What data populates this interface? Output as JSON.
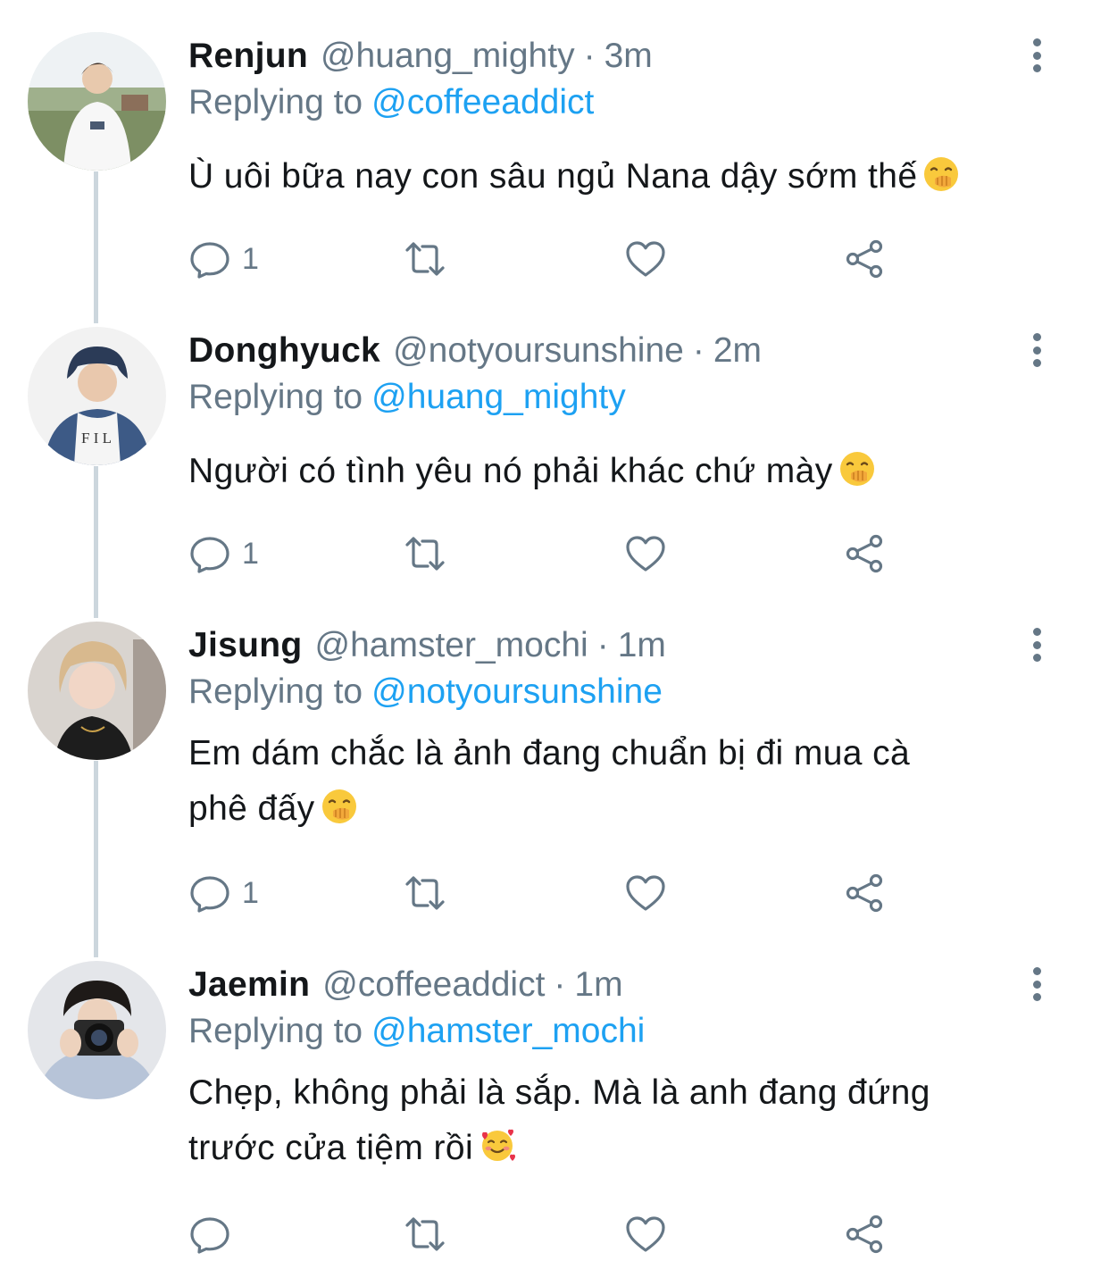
{
  "tweets": [
    {
      "name": "Renjun",
      "handle": "@huang_mighty",
      "time": "3m",
      "replying_label": "Replying to",
      "replying_to": "@coffeeaddict",
      "text": "Ù uôi bữa nay con sâu ngủ Nana dậy sớm thế",
      "emoji": "face-with-hand-over-mouth",
      "reply_count": "1"
    },
    {
      "name": "Donghyuck",
      "handle": "@notyoursunshine",
      "time": "2m",
      "replying_label": "Replying to",
      "replying_to": "@huang_mighty",
      "text": "Người có tình yêu nó phải khác chứ mày",
      "emoji": "face-with-hand-over-mouth",
      "reply_count": "1"
    },
    {
      "name": "Jisung",
      "handle": "@hamster_mochi",
      "time": "1m",
      "replying_label": "Replying to",
      "replying_to": "@notyoursunshine",
      "text_line1": "Em dám chắc là ảnh đang chuẩn bị đi mua cà",
      "text_line2": "phê đấy",
      "emoji": "face-with-hand-over-mouth",
      "reply_count": "1"
    },
    {
      "name": "Jaemin",
      "handle": "@coffeeaddict",
      "time": "1m",
      "replying_label": "Replying to",
      "replying_to": "@hamster_mochi",
      "text_line1": "Chẹp, không phải là sắp. Mà là anh đang đứng",
      "text_line2": "trước cửa tiệm rồi",
      "emoji": "smiling-face-with-hearts",
      "reply_count": ""
    }
  ],
  "separator": "·",
  "colors": {
    "text": "#14171a",
    "secondary": "#657786",
    "accent": "#1da1f2",
    "thread_line": "#ccd6dd"
  },
  "icons": {
    "reply": "reply-icon",
    "retweet": "retweet-icon",
    "like": "heart-icon",
    "share": "share-icon",
    "more": "more-options-icon"
  }
}
